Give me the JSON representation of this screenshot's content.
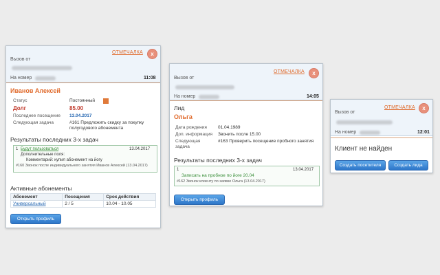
{
  "colors": {
    "accent": "#e06a2b",
    "link": "#2a6ab3",
    "button": "#3b86d8",
    "green": "#3a8e3a",
    "red": "#c0392b"
  },
  "card1": {
    "otmechalka": "ОТМЕЧАЛКА",
    "close": "x",
    "call_from": "Вызов от",
    "to_number": "На номер",
    "time": "11:08",
    "client_name": "Иванов Алексей",
    "status_label": "Статус",
    "status_value": "Постоянный",
    "debt_label": "Долг",
    "debt_value": "85.00",
    "last_visit_label": "Последнее посещение",
    "last_visit_value": "13.04.2017",
    "next_task_label": "Следующая задача",
    "next_task_value": "#161 Предложить скидку за покупку полугодового абонемента",
    "results_title": "Результаты последних 3-х задач",
    "task": {
      "num": "1",
      "title": "Будут пользоваться",
      "date": "13.04.2017",
      "extra": "Дополнительные поля:",
      "comment": "Комментарий: купил абонемент на йогу",
      "footer": "#160 Звонок после индивидуального занятия Иванов Алексей (13.04.2017)"
    },
    "subs_title": "Активные абонементы",
    "subs_headers": [
      "Абонемент",
      "Посещения",
      "Срок действия"
    ],
    "subs_row": [
      "Универсальный",
      "2 / 5",
      "10.04 - 10.05"
    ],
    "open_profile": "Открыть профиль"
  },
  "card2": {
    "otmechalka": "ОТМЕЧАЛКА",
    "close": "x",
    "call_from": "Вызов от",
    "to_number": "На номер",
    "time": "14:05",
    "lead_label": "Лид",
    "lead_name": "Ольга",
    "dob_label": "Дата рождения",
    "dob_value": "01.04.1989",
    "info_label": "Доп. информация",
    "info_value": "Звонить после 15.00",
    "next_task_label": "Следующая задача",
    "next_task_value": "#163 Проверить посещение пробного занятия",
    "results_title": "Результаты последних 3-х задач",
    "task": {
      "num": "1",
      "date": "13.04.2017",
      "title": "Записать на пробное по йоге 20.04",
      "footer": "#162 Звонок клиенту по заявке Ольга (13.04.2017)"
    },
    "open_profile": "Открыть профиль"
  },
  "card3": {
    "otmechalka": "ОТМЕЧАЛКА",
    "close": "x",
    "call_from": "Вызов от",
    "to_number": "На номер",
    "time": "12:01",
    "not_found": "Клиент не найден",
    "create_visitor": "Создать посетителя",
    "create_lead": "Создать лида"
  }
}
